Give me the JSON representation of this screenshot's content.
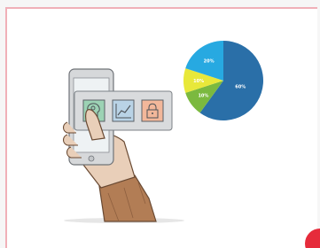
{
  "colors": {
    "card_border": "#f0b0b8",
    "pie_dark_blue": "#2a6fa8",
    "pie_light_blue": "#27a9e1",
    "pie_yellow": "#e8e83a",
    "pie_green": "#7bb93f",
    "accent_red": "#e62b3b"
  },
  "icons": {
    "app_1": "head-with-gear-icon",
    "app_2": "line-chart-icon",
    "app_3": "padlock-icon"
  },
  "chart_data": {
    "type": "pie",
    "slices": [
      {
        "label": "60%",
        "value": 60,
        "color": "#2a6fa8"
      },
      {
        "label": "10%",
        "value": 10,
        "color": "#7bb93f"
      },
      {
        "label": "10%",
        "value": 10,
        "color": "#e8e83a"
      },
      {
        "label": "20%",
        "value": 20,
        "color": "#27a9e1"
      }
    ]
  }
}
